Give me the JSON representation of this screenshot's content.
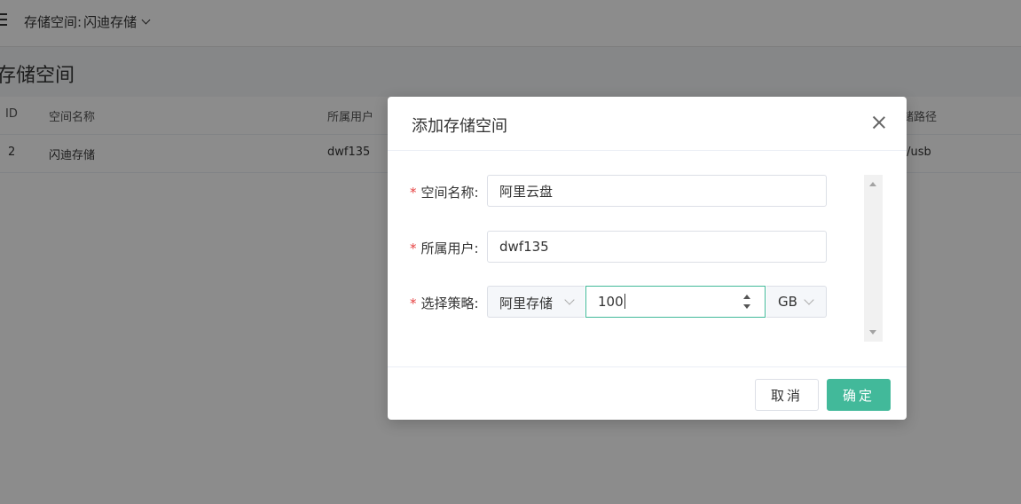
{
  "header": {
    "space_label": "存储空间:",
    "space_value": "闪迪存储"
  },
  "page": {
    "title": "存储空间"
  },
  "table": {
    "columns": {
      "id": "ID",
      "name": "空间名称",
      "user": "所属用户",
      "path": "储路径"
    },
    "rows": [
      {
        "id": "2",
        "name": "闪迪存储",
        "user": "dwf135",
        "path": "t/usb"
      }
    ]
  },
  "dialog": {
    "title": "添加存储空间",
    "required_mark": "*",
    "fields": {
      "name": {
        "label": "空间名称:",
        "value": "阿里云盘"
      },
      "user": {
        "label": "所属用户:",
        "value": "dwf135"
      },
      "policy": {
        "label": "选择策略:",
        "policy_value": "阿里存储",
        "size_value": "100",
        "unit_value": "GB"
      }
    },
    "cancel_label": "取消",
    "confirm_label": "确定"
  },
  "colors": {
    "accent": "#42b99a",
    "required": "#e64242",
    "overlay": "rgba(0,0,0,0.45)"
  },
  "icons": {
    "menu": "menu-icon",
    "dropdown": "chevron-down-icon",
    "close": "close-icon",
    "spin_up": "spin-up-icon",
    "spin_down": "spin-down-icon"
  }
}
